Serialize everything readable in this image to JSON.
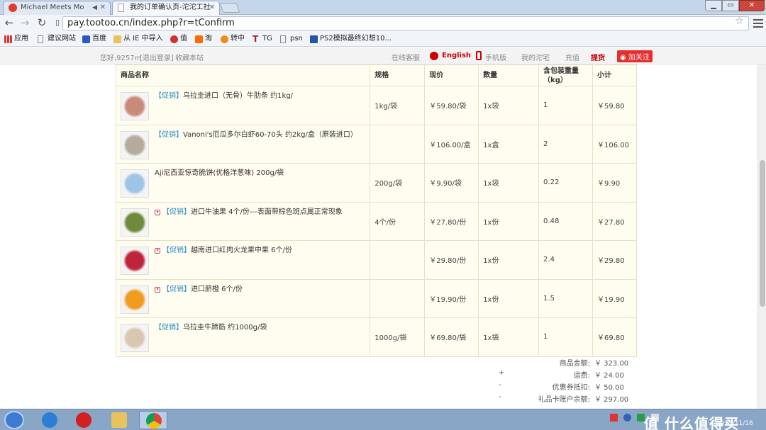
{
  "browser": {
    "tabs": [
      {
        "title": "Michael Meets Mo",
        "active": false
      },
      {
        "title": "我的订单确认页-沱沱工社",
        "active": true
      }
    ],
    "address": "pay.tootoo.cn/index.php?r=tConfirm",
    "bookmarks": [
      "应用",
      "建议网站",
      "百度",
      "从 IE 中导入",
      "值",
      "淘",
      "转中",
      "TG",
      "psn",
      "PS2模拟最终幻想10..."
    ]
  },
  "site_bar": {
    "greeting": "您好,9257m",
    "logout": "[退出登录]",
    "favorite": "收藏本站",
    "service": "在线客服",
    "english": "English",
    "mobile": "手机版",
    "my_account": "我的沱宅",
    "recharge": "充值",
    "pickup": "提货",
    "follow": "加关注"
  },
  "order": {
    "headers": {
      "name": "商品名称",
      "spec": "规格",
      "price": "现价",
      "qty": "数量",
      "weight": "含包装重量（kg）",
      "subtotal": "小计"
    },
    "items": [
      {
        "promo": "【促销】",
        "dropdown": false,
        "name": "乌拉圭进口（无骨）牛肋条 约1kg/",
        "spec": "1kg/袋",
        "price": "￥59.80/袋",
        "qty": "1x袋",
        "weight": "1",
        "subtotal": "￥59.80"
      },
      {
        "promo": "【促销】",
        "dropdown": false,
        "name": "Vanoni's厄瓜多尔白虾60-70头 约2kg/盒（原装进口）",
        "spec": "",
        "price": "￥106.00/盒",
        "qty": "1x盒",
        "weight": "2",
        "subtotal": "￥106.00"
      },
      {
        "promo": "",
        "dropdown": false,
        "name": "Aji尼西亚惊奇脆饼(优格洋葱味) 200g/袋",
        "spec": "200g/袋",
        "price": "￥9.90/袋",
        "qty": "1x袋",
        "weight": "0.22",
        "subtotal": "￥9.90"
      },
      {
        "promo": "【促销】",
        "dropdown": true,
        "name": "进口牛油果 4个/份---表面带棕色斑点属正常现象",
        "spec": "4个/份",
        "price": "￥27.80/份",
        "qty": "1x份",
        "weight": "0.48",
        "subtotal": "￥27.80"
      },
      {
        "promo": "【促销】",
        "dropdown": true,
        "name": "越南进口红肉火龙果中果 6个/份",
        "spec": "",
        "price": "￥29.80/份",
        "qty": "1x份",
        "weight": "2.4",
        "subtotal": "￥29.80"
      },
      {
        "promo": "【促销】",
        "dropdown": true,
        "name": "进口脐橙 6个/份",
        "spec": "",
        "price": "￥19.90/份",
        "qty": "1x份",
        "weight": "1.5",
        "subtotal": "￥19.90"
      },
      {
        "promo": "【促销】",
        "dropdown": false,
        "name": "乌拉圭牛蹄筋 约1000g/袋",
        "spec": "1000g/袋",
        "price": "￥69.80/袋",
        "qty": "1x袋",
        "weight": "1",
        "subtotal": "￥69.80"
      }
    ],
    "totals": [
      {
        "sign": "",
        "label": "商品金额:",
        "value": "￥ 323.00"
      },
      {
        "sign": "+",
        "label": "运费:",
        "value": "￥ 24.00"
      },
      {
        "sign": "-",
        "label": "优惠券抵扣:",
        "value": "￥ 50.00"
      },
      {
        "sign": "-",
        "label": "礼品卡账户余额:",
        "value": "￥ 297.00"
      }
    ]
  },
  "taskbar": {
    "clock": "2015/11/16",
    "watermark": "值 什么值得买"
  },
  "colors": {
    "accent_red": "#cc0000",
    "promo_blue": "#2c8ec9",
    "table_bg": "#fffdef"
  }
}
